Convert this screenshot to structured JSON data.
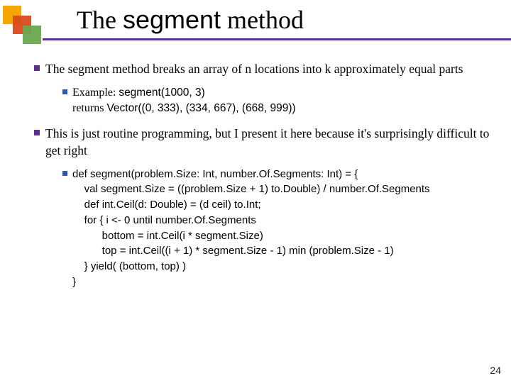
{
  "title": {
    "pre": "The ",
    "em": "segment",
    "post": " method"
  },
  "bullets": {
    "b1": "The segment method breaks an array of n locations into k approximately equal parts",
    "b1sub": {
      "lead": "Example: ",
      "call": "segment(1000, 3)",
      "ret_lead": "returns ",
      "ret_val": "Vector((0, 333), (334, 667), (668, 999))"
    },
    "b2": "This is just routine programming, but I present it here because it's surprisingly difficult to get right",
    "b2code": "def segment(problem.Size: Int, number.Of.Segments: Int) = {\n    val segment.Size = ((problem.Size + 1) to.Double) / number.Of.Segments\n    def int.Ceil(d: Double) = (d ceil) to.Int;\n    for { i <- 0 until number.Of.Segments\n          bottom = int.Ceil(i * segment.Size)\n          top = int.Ceil((i + 1) * segment.Size - 1) min (problem.Size - 1)\n    } yield( (bottom, top) )\n}"
  },
  "slide_number": "24"
}
